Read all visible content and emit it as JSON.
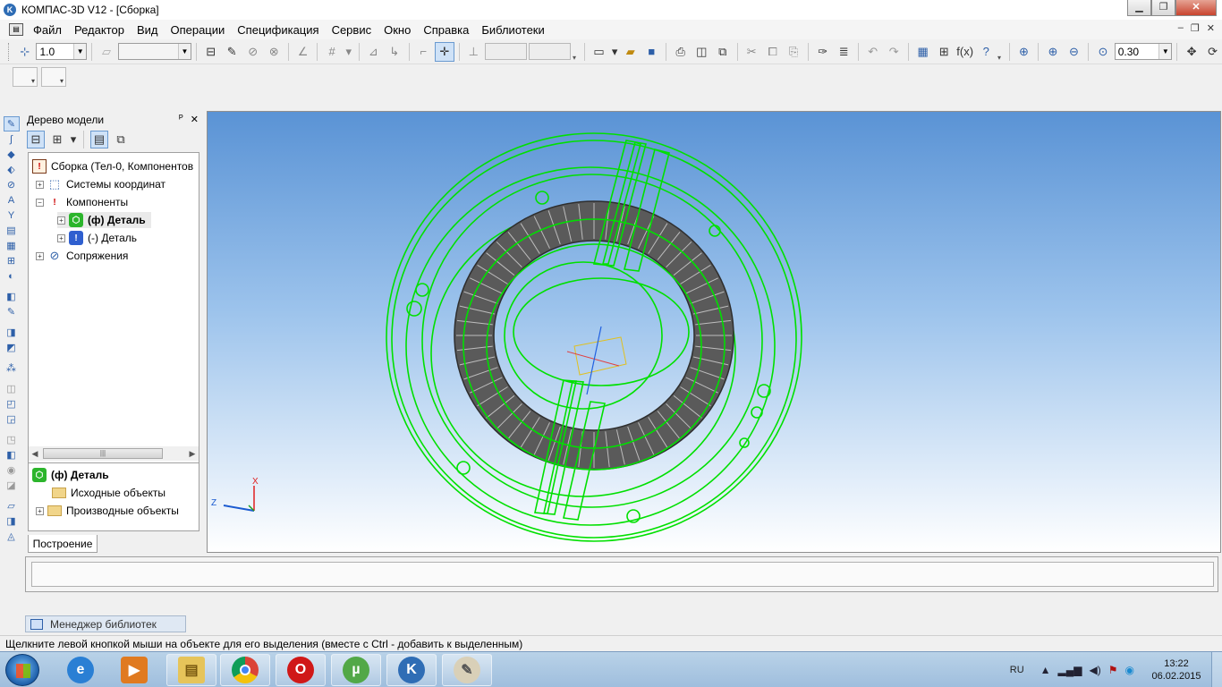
{
  "window": {
    "title": "КОМПАС-3D V12 - [Сборка]",
    "app_icon": "kompas-logo-icon"
  },
  "menu": {
    "items": [
      "Файл",
      "Редактор",
      "Вид",
      "Операции",
      "Спецификация",
      "Сервис",
      "Окно",
      "Справка",
      "Библиотеки"
    ]
  },
  "toolbar": {
    "step_value": "1.0",
    "zoom_value": "0.30"
  },
  "tree_panel": {
    "title": "Дерево модели",
    "items": [
      {
        "label": "Сборка (Тел-0, Компонентов"
      },
      {
        "label": "Системы координат"
      },
      {
        "label": "Компоненты"
      },
      {
        "label": "(ф) Деталь"
      },
      {
        "label": "(-) Деталь"
      },
      {
        "label": "Сопряжения"
      }
    ],
    "lower_title": "(ф) Деталь",
    "lower_items": [
      {
        "label": "Исходные объекты"
      },
      {
        "label": "Производные объекты"
      }
    ],
    "tab": "Построение"
  },
  "viewport": {
    "axis_x": "X",
    "axis_z": "Z"
  },
  "library_manager": {
    "label": "Менеджер библиотек"
  },
  "status_bar": {
    "message": "Щелкните левой кнопкой мыши на объекте для его выделения (вместе с Ctrl - добавить к выделенным)"
  },
  "taskbar": {
    "language": "RU",
    "time": "13:22",
    "date": "06.02.2015"
  },
  "colors": {
    "wireframe": "#00e000",
    "core": "#5a5a5a",
    "viewport_top": "#5a93d5"
  }
}
